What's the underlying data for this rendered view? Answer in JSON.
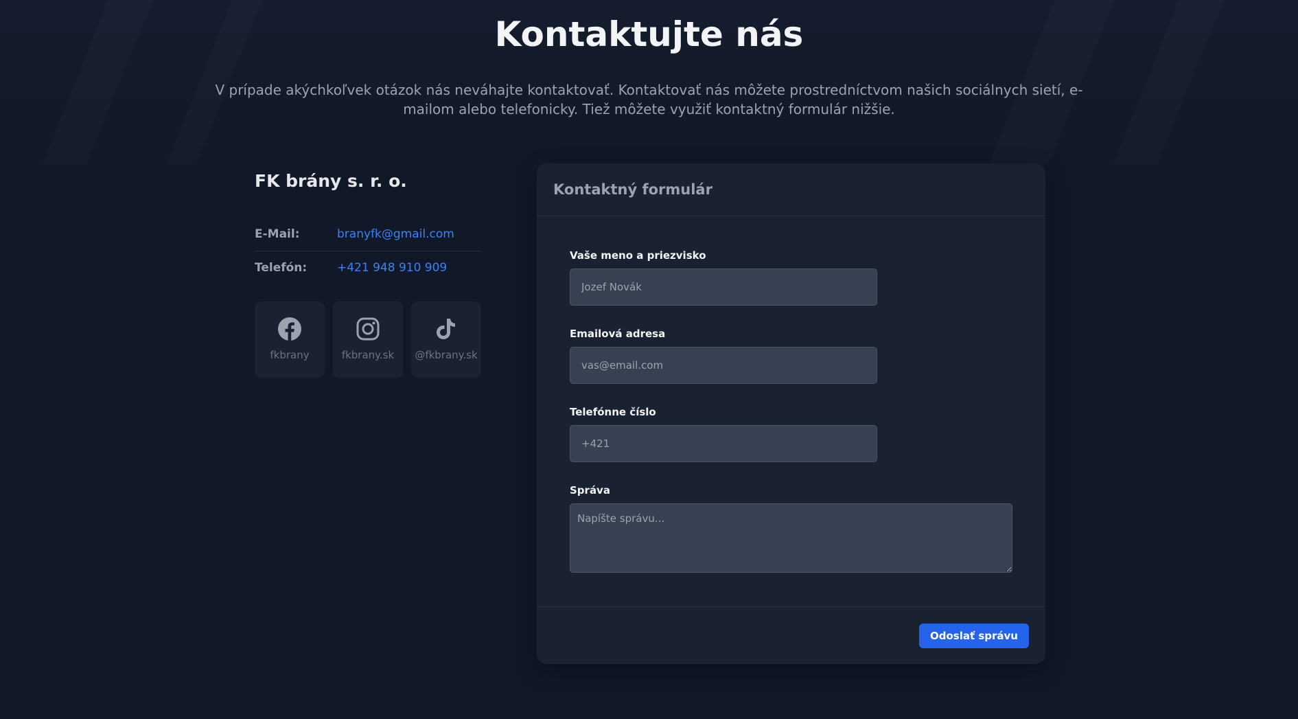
{
  "header": {
    "title": "Kontaktujte nás",
    "subtitle": "V prípade akýchkoľvek otázok nás neváhajte kontaktovať. Kontaktovať nás môžete prostredníctvom našich sociálnych sietí, e-mailom alebo telefonicky. Tiež môžete využiť kontaktný formulár nižšie."
  },
  "company": {
    "name": "FK brány s. r. o.",
    "email_label": "E-Mail:",
    "email_value": "branyfk@gmail.com",
    "phone_label": "Telefón:",
    "phone_value": "+421 948 910 909"
  },
  "socials": [
    {
      "icon": "facebook-icon",
      "handle": "fkbrany"
    },
    {
      "icon": "instagram-icon",
      "handle": "fkbrany.sk"
    },
    {
      "icon": "tiktok-icon",
      "handle": "@fkbrany.sk"
    }
  ],
  "form": {
    "title": "Kontaktný formulár",
    "name_label": "Vaše meno a priezvisko",
    "name_placeholder": "Jozef Novák",
    "email_label": "Emailová adresa",
    "email_placeholder": "vas@email.com",
    "phone_label": "Telefónne číslo",
    "phone_placeholder": "+421",
    "message_label": "Správa",
    "message_placeholder": "Napíšte správu...",
    "submit_label": "Odoslať správu"
  },
  "colors": {
    "background": "#111827",
    "card": "#1a2232",
    "input": "#374151",
    "accent": "#2563eb",
    "link": "#3b82f6",
    "muted": "#9ca3af"
  }
}
